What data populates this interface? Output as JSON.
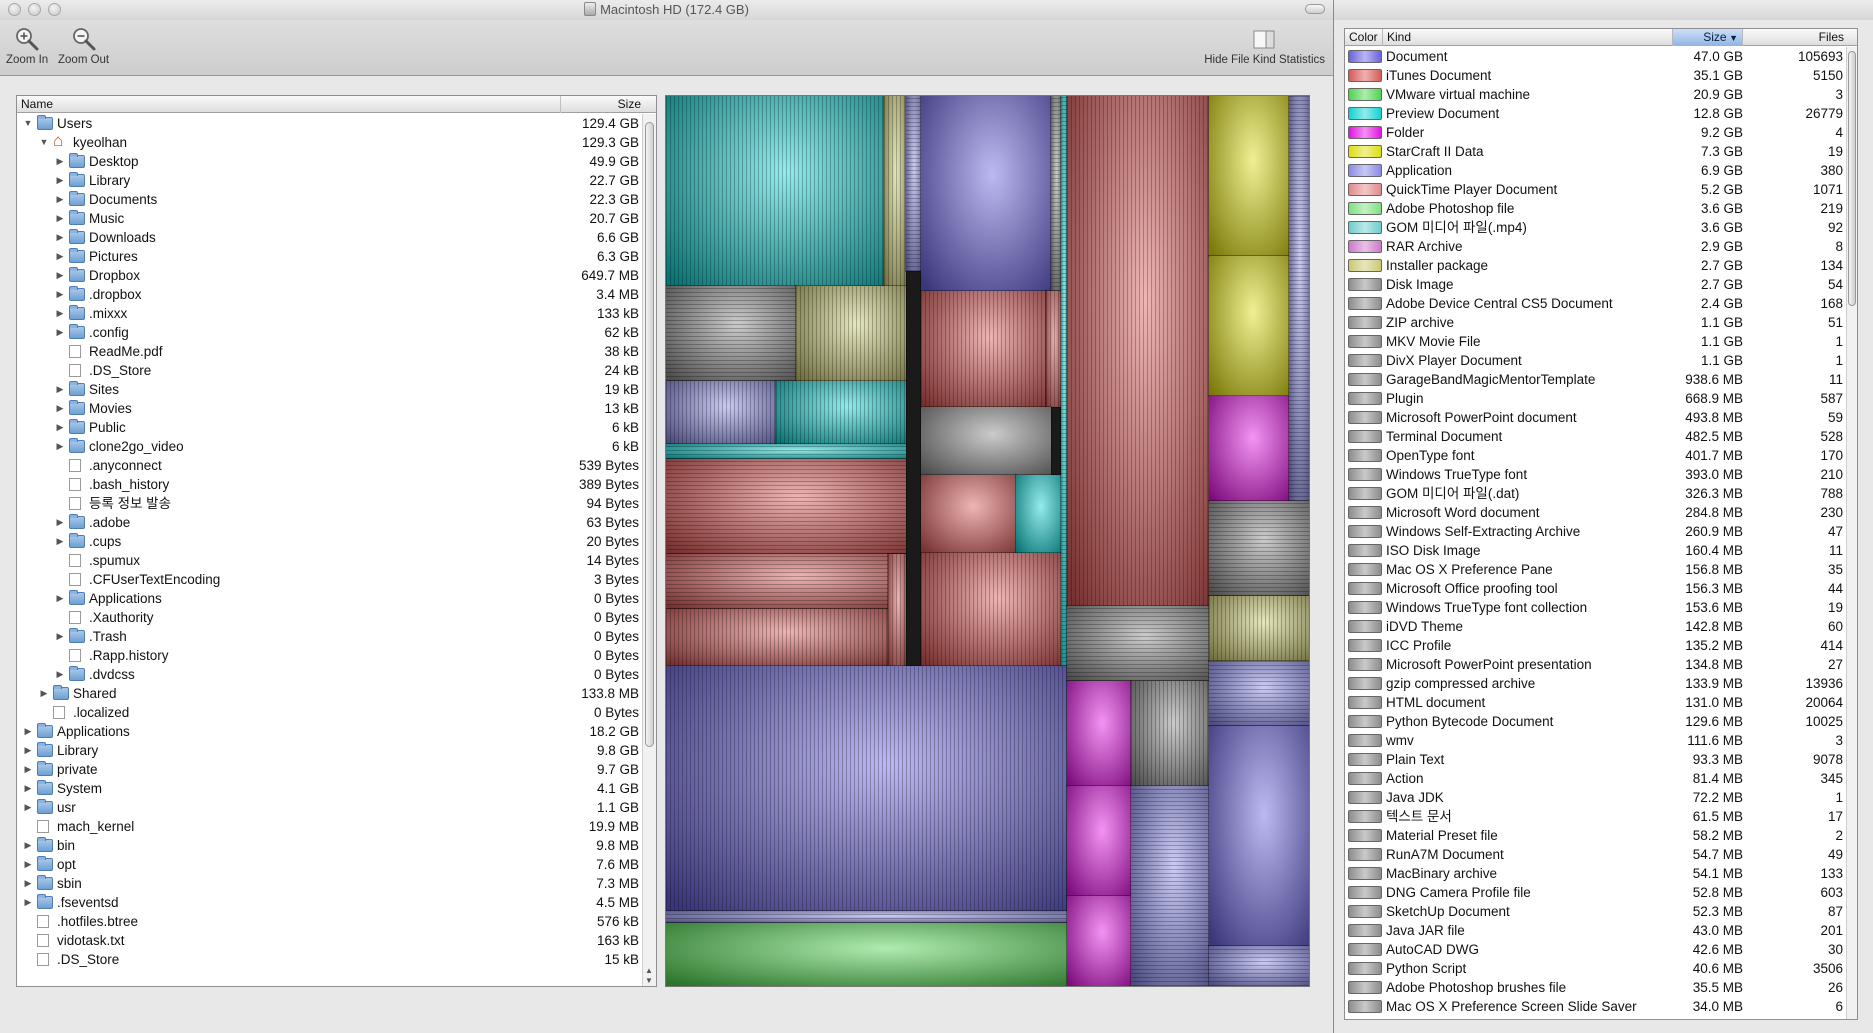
{
  "window": {
    "title": "Macintosh HD (172.4 GB)"
  },
  "toolbar": {
    "zoom_in": "Zoom In",
    "zoom_out": "Zoom Out",
    "hide_stats": "Hide File Kind Statistics"
  },
  "tree": {
    "col_name": "Name",
    "col_size": "Size",
    "rows": [
      {
        "name": "Users",
        "size": "129.4 GB",
        "depth": 0,
        "disc": "open",
        "icon": "folder"
      },
      {
        "name": "kyeolhan",
        "size": "129.3 GB",
        "depth": 1,
        "disc": "open",
        "icon": "home"
      },
      {
        "name": "Desktop",
        "size": "49.9 GB",
        "depth": 2,
        "disc": "closed",
        "icon": "folder"
      },
      {
        "name": "Library",
        "size": "22.7 GB",
        "depth": 2,
        "disc": "closed",
        "icon": "folder"
      },
      {
        "name": "Documents",
        "size": "22.3 GB",
        "depth": 2,
        "disc": "closed",
        "icon": "folder"
      },
      {
        "name": "Music",
        "size": "20.7 GB",
        "depth": 2,
        "disc": "closed",
        "icon": "folder"
      },
      {
        "name": "Downloads",
        "size": "6.6 GB",
        "depth": 2,
        "disc": "closed",
        "icon": "folder"
      },
      {
        "name": "Pictures",
        "size": "6.3 GB",
        "depth": 2,
        "disc": "closed",
        "icon": "folder"
      },
      {
        "name": "Dropbox",
        "size": "649.7 MB",
        "depth": 2,
        "disc": "closed",
        "icon": "folder"
      },
      {
        "name": ".dropbox",
        "size": "3.4 MB",
        "depth": 2,
        "disc": "closed",
        "icon": "folder"
      },
      {
        "name": ".mixxx",
        "size": "133 kB",
        "depth": 2,
        "disc": "closed",
        "icon": "folder"
      },
      {
        "name": ".config",
        "size": "62 kB",
        "depth": 2,
        "disc": "closed",
        "icon": "folder"
      },
      {
        "name": "ReadMe.pdf",
        "size": "38 kB",
        "depth": 2,
        "disc": "none",
        "icon": "file"
      },
      {
        "name": ".DS_Store",
        "size": "24 kB",
        "depth": 2,
        "disc": "none",
        "icon": "file"
      },
      {
        "name": "Sites",
        "size": "19 kB",
        "depth": 2,
        "disc": "closed",
        "icon": "folder"
      },
      {
        "name": "Movies",
        "size": "13 kB",
        "depth": 2,
        "disc": "closed",
        "icon": "folder"
      },
      {
        "name": "Public",
        "size": "6 kB",
        "depth": 2,
        "disc": "closed",
        "icon": "folder"
      },
      {
        "name": "clone2go_video",
        "size": "6 kB",
        "depth": 2,
        "disc": "closed",
        "icon": "folder"
      },
      {
        "name": ".anyconnect",
        "size": "539 Bytes",
        "depth": 2,
        "disc": "none",
        "icon": "file"
      },
      {
        "name": ".bash_history",
        "size": "389 Bytes",
        "depth": 2,
        "disc": "none",
        "icon": "file"
      },
      {
        "name": "등록 정보 발송",
        "size": "94 Bytes",
        "depth": 2,
        "disc": "none",
        "icon": "file"
      },
      {
        "name": ".adobe",
        "size": "63 Bytes",
        "depth": 2,
        "disc": "closed",
        "icon": "folder"
      },
      {
        "name": ".cups",
        "size": "20 Bytes",
        "depth": 2,
        "disc": "closed",
        "icon": "folder"
      },
      {
        "name": ".spumux",
        "size": "14 Bytes",
        "depth": 2,
        "disc": "none",
        "icon": "file"
      },
      {
        "name": ".CFUserTextEncoding",
        "size": "3 Bytes",
        "depth": 2,
        "disc": "none",
        "icon": "file"
      },
      {
        "name": "Applications",
        "size": "0 Bytes",
        "depth": 2,
        "disc": "closed",
        "icon": "folder"
      },
      {
        "name": ".Xauthority",
        "size": "0 Bytes",
        "depth": 2,
        "disc": "none",
        "icon": "file"
      },
      {
        "name": ".Trash",
        "size": "0 Bytes",
        "depth": 2,
        "disc": "closed",
        "icon": "folder"
      },
      {
        "name": ".Rapp.history",
        "size": "0 Bytes",
        "depth": 2,
        "disc": "none",
        "icon": "file"
      },
      {
        "name": ".dvdcss",
        "size": "0 Bytes",
        "depth": 2,
        "disc": "closed",
        "icon": "folder"
      },
      {
        "name": "Shared",
        "size": "133.8 MB",
        "depth": 1,
        "disc": "closed",
        "icon": "folder"
      },
      {
        "name": ".localized",
        "size": "0 Bytes",
        "depth": 1,
        "disc": "none",
        "icon": "file"
      },
      {
        "name": "Applications",
        "size": "18.2 GB",
        "depth": 0,
        "disc": "closed",
        "icon": "folder"
      },
      {
        "name": "Library",
        "size": "9.8 GB",
        "depth": 0,
        "disc": "closed",
        "icon": "folder"
      },
      {
        "name": "private",
        "size": "9.7 GB",
        "depth": 0,
        "disc": "closed",
        "icon": "folder"
      },
      {
        "name": "System",
        "size": "4.1 GB",
        "depth": 0,
        "disc": "closed",
        "icon": "folder"
      },
      {
        "name": "usr",
        "size": "1.1 GB",
        "depth": 0,
        "disc": "closed",
        "icon": "folder"
      },
      {
        "name": "mach_kernel",
        "size": "19.9 MB",
        "depth": 0,
        "disc": "none",
        "icon": "file"
      },
      {
        "name": "bin",
        "size": "9.8 MB",
        "depth": 0,
        "disc": "closed",
        "icon": "folder"
      },
      {
        "name": "opt",
        "size": "7.6 MB",
        "depth": 0,
        "disc": "closed",
        "icon": "folder"
      },
      {
        "name": "sbin",
        "size": "7.3 MB",
        "depth": 0,
        "disc": "closed",
        "icon": "folder"
      },
      {
        "name": ".fseventsd",
        "size": "4.5 MB",
        "depth": 0,
        "disc": "closed",
        "icon": "folder"
      },
      {
        "name": ".hotfiles.btree",
        "size": "576 kB",
        "depth": 0,
        "disc": "none",
        "icon": "file"
      },
      {
        "name": "vidotask.txt",
        "size": "163 kB",
        "depth": 0,
        "disc": "none",
        "icon": "file"
      },
      {
        "name": ".DS_Store",
        "size": "15 kB",
        "depth": 0,
        "disc": "none",
        "icon": "file"
      }
    ]
  },
  "stats": {
    "col_color": "Color",
    "col_kind": "Kind",
    "col_size": "Size",
    "col_files": "Files",
    "sorted_column": "Size",
    "rows": [
      {
        "kind": "Document",
        "size": "47.0 GB",
        "files": "105693",
        "color": "#6a63e0"
      },
      {
        "kind": "iTunes Document",
        "size": "35.1 GB",
        "files": "5150",
        "color": "#d85a58"
      },
      {
        "kind": "VMware virtual machine",
        "size": "20.9 GB",
        "files": "3",
        "color": "#4fd44e"
      },
      {
        "kind": "Preview Document",
        "size": "12.8 GB",
        "files": "26779",
        "color": "#12d3d3"
      },
      {
        "kind": "Folder",
        "size": "9.2 GB",
        "files": "4",
        "color": "#e312e3"
      },
      {
        "kind": "StarCraft II Data",
        "size": "7.3 GB",
        "files": "19",
        "color": "#dede10"
      },
      {
        "kind": "Application",
        "size": "6.9 GB",
        "files": "380",
        "color": "#8a8ae6"
      },
      {
        "kind": "QuickTime Player Document",
        "size": "5.2 GB",
        "files": "1071",
        "color": "#e08a8a"
      },
      {
        "kind": "Adobe Photoshop file",
        "size": "3.6 GB",
        "files": "219",
        "color": "#7fe07f"
      },
      {
        "kind": "GOM 미디어 파일(.mp4)",
        "size": "3.6 GB",
        "files": "92",
        "color": "#70cccc"
      },
      {
        "kind": "RAR Archive",
        "size": "2.9 GB",
        "files": "8",
        "color": "#cc7acc"
      },
      {
        "kind": "Installer package",
        "size": "2.7 GB",
        "files": "134",
        "color": "#caca72"
      },
      {
        "kind": "Disk Image",
        "size": "2.7 GB",
        "files": "54",
        "color": "#8c8c8c"
      },
      {
        "kind": "Adobe Device Central CS5 Document",
        "size": "2.4 GB",
        "files": "168",
        "color": "#8c8c8c"
      },
      {
        "kind": "ZIP archive",
        "size": "1.1 GB",
        "files": "51",
        "color": "#8c8c8c"
      },
      {
        "kind": "MKV Movie File",
        "size": "1.1 GB",
        "files": "1",
        "color": "#8c8c8c"
      },
      {
        "kind": "DivX Player Document",
        "size": "1.1 GB",
        "files": "1",
        "color": "#8c8c8c"
      },
      {
        "kind": "GarageBandMagicMentorTemplate",
        "size": "938.6 MB",
        "files": "11",
        "color": "#8c8c8c"
      },
      {
        "kind": "Plugin",
        "size": "668.9 MB",
        "files": "587",
        "color": "#8c8c8c"
      },
      {
        "kind": "Microsoft PowerPoint document",
        "size": "493.8 MB",
        "files": "59",
        "color": "#8c8c8c"
      },
      {
        "kind": "Terminal Document",
        "size": "482.5 MB",
        "files": "528",
        "color": "#8c8c8c"
      },
      {
        "kind": "OpenType font",
        "size": "401.7 MB",
        "files": "170",
        "color": "#8c8c8c"
      },
      {
        "kind": "Windows TrueType font",
        "size": "393.0 MB",
        "files": "210",
        "color": "#8c8c8c"
      },
      {
        "kind": "GOM 미디어 파일(.dat)",
        "size": "326.3 MB",
        "files": "788",
        "color": "#8c8c8c"
      },
      {
        "kind": "Microsoft Word document",
        "size": "284.8 MB",
        "files": "230",
        "color": "#8c8c8c"
      },
      {
        "kind": "Windows Self-Extracting Archive",
        "size": "260.9 MB",
        "files": "47",
        "color": "#8c8c8c"
      },
      {
        "kind": "ISO Disk Image",
        "size": "160.4 MB",
        "files": "11",
        "color": "#8c8c8c"
      },
      {
        "kind": "Mac OS X Preference Pane",
        "size": "156.8 MB",
        "files": "35",
        "color": "#8c8c8c"
      },
      {
        "kind": "Microsoft Office proofing tool",
        "size": "156.3 MB",
        "files": "44",
        "color": "#8c8c8c"
      },
      {
        "kind": "Windows TrueType font collection",
        "size": "153.6 MB",
        "files": "19",
        "color": "#8c8c8c"
      },
      {
        "kind": "iDVD Theme",
        "size": "142.8 MB",
        "files": "60",
        "color": "#8c8c8c"
      },
      {
        "kind": "ICC Profile",
        "size": "135.2 MB",
        "files": "414",
        "color": "#8c8c8c"
      },
      {
        "kind": "Microsoft PowerPoint presentation",
        "size": "134.8 MB",
        "files": "27",
        "color": "#8c8c8c"
      },
      {
        "kind": "gzip compressed archive",
        "size": "133.9 MB",
        "files": "13936",
        "color": "#8c8c8c"
      },
      {
        "kind": "HTML document",
        "size": "131.0 MB",
        "files": "20064",
        "color": "#8c8c8c"
      },
      {
        "kind": "Python Bytecode Document",
        "size": "129.6 MB",
        "files": "10025",
        "color": "#8c8c8c"
      },
      {
        "kind": "wmv",
        "size": "111.6 MB",
        "files": "3",
        "color": "#8c8c8c"
      },
      {
        "kind": "Plain Text",
        "size": "93.3 MB",
        "files": "9078",
        "color": "#8c8c8c"
      },
      {
        "kind": "Action",
        "size": "81.4 MB",
        "files": "345",
        "color": "#8c8c8c"
      },
      {
        "kind": "Java JDK",
        "size": "72.2 MB",
        "files": "1",
        "color": "#8c8c8c"
      },
      {
        "kind": "텍스트 문서",
        "size": "61.5 MB",
        "files": "17",
        "color": "#8c8c8c"
      },
      {
        "kind": "Material Preset file",
        "size": "58.2 MB",
        "files": "2",
        "color": "#8c8c8c"
      },
      {
        "kind": "RunA7M Document",
        "size": "54.7 MB",
        "files": "49",
        "color": "#8c8c8c"
      },
      {
        "kind": "MacBinary archive",
        "size": "54.1 MB",
        "files": "133",
        "color": "#8c8c8c"
      },
      {
        "kind": "DNG Camera Profile file",
        "size": "52.8 MB",
        "files": "603",
        "color": "#8c8c8c"
      },
      {
        "kind": "SketchUp Document",
        "size": "52.3 MB",
        "files": "87",
        "color": "#8c8c8c"
      },
      {
        "kind": "Java JAR file",
        "size": "43.0 MB",
        "files": "201",
        "color": "#8c8c8c"
      },
      {
        "kind": "AutoCAD DWG",
        "size": "42.6 MB",
        "files": "30",
        "color": "#8c8c8c"
      },
      {
        "kind": "Python Script",
        "size": "40.6 MB",
        "files": "3506",
        "color": "#8c8c8c"
      },
      {
        "kind": "Adobe Photoshop brushes file",
        "size": "35.5 MB",
        "files": "26",
        "color": "#8c8c8c"
      },
      {
        "kind": "Mac OS X Preference Screen Slide Saver",
        "size": "34.0 MB",
        "files": "6",
        "color": "#8c8c8c"
      }
    ]
  }
}
